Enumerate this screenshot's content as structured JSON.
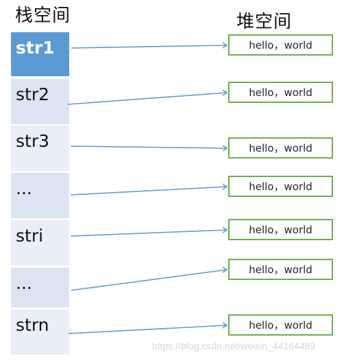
{
  "titles": {
    "stack": "栈空间",
    "heap": "堆空间"
  },
  "stack": [
    {
      "label": "str1",
      "style": "active"
    },
    {
      "label": "str2",
      "style": "dark"
    },
    {
      "label": "str3",
      "style": "alt"
    },
    {
      "label": "...",
      "style": "dark"
    },
    {
      "label": "stri",
      "style": "alt"
    },
    {
      "label": "...",
      "style": "dark"
    },
    {
      "label": "strn",
      "style": "alt"
    }
  ],
  "heap": [
    {
      "label": "hello，world"
    },
    {
      "label": "hello，world"
    },
    {
      "label": "hello，world"
    },
    {
      "label": "hello，world"
    },
    {
      "label": "hello，world"
    },
    {
      "label": "hello，world"
    },
    {
      "label": "hello，world"
    }
  ],
  "colors": {
    "active_cell": "#5b9bd5",
    "cell_dark": "#dbe4f1",
    "cell_light": "#e9eef7",
    "box_border": "#70ad47",
    "arrow": "#5b9bd5"
  },
  "watermark": "https://blog.csdn.net/weixin_44164489"
}
